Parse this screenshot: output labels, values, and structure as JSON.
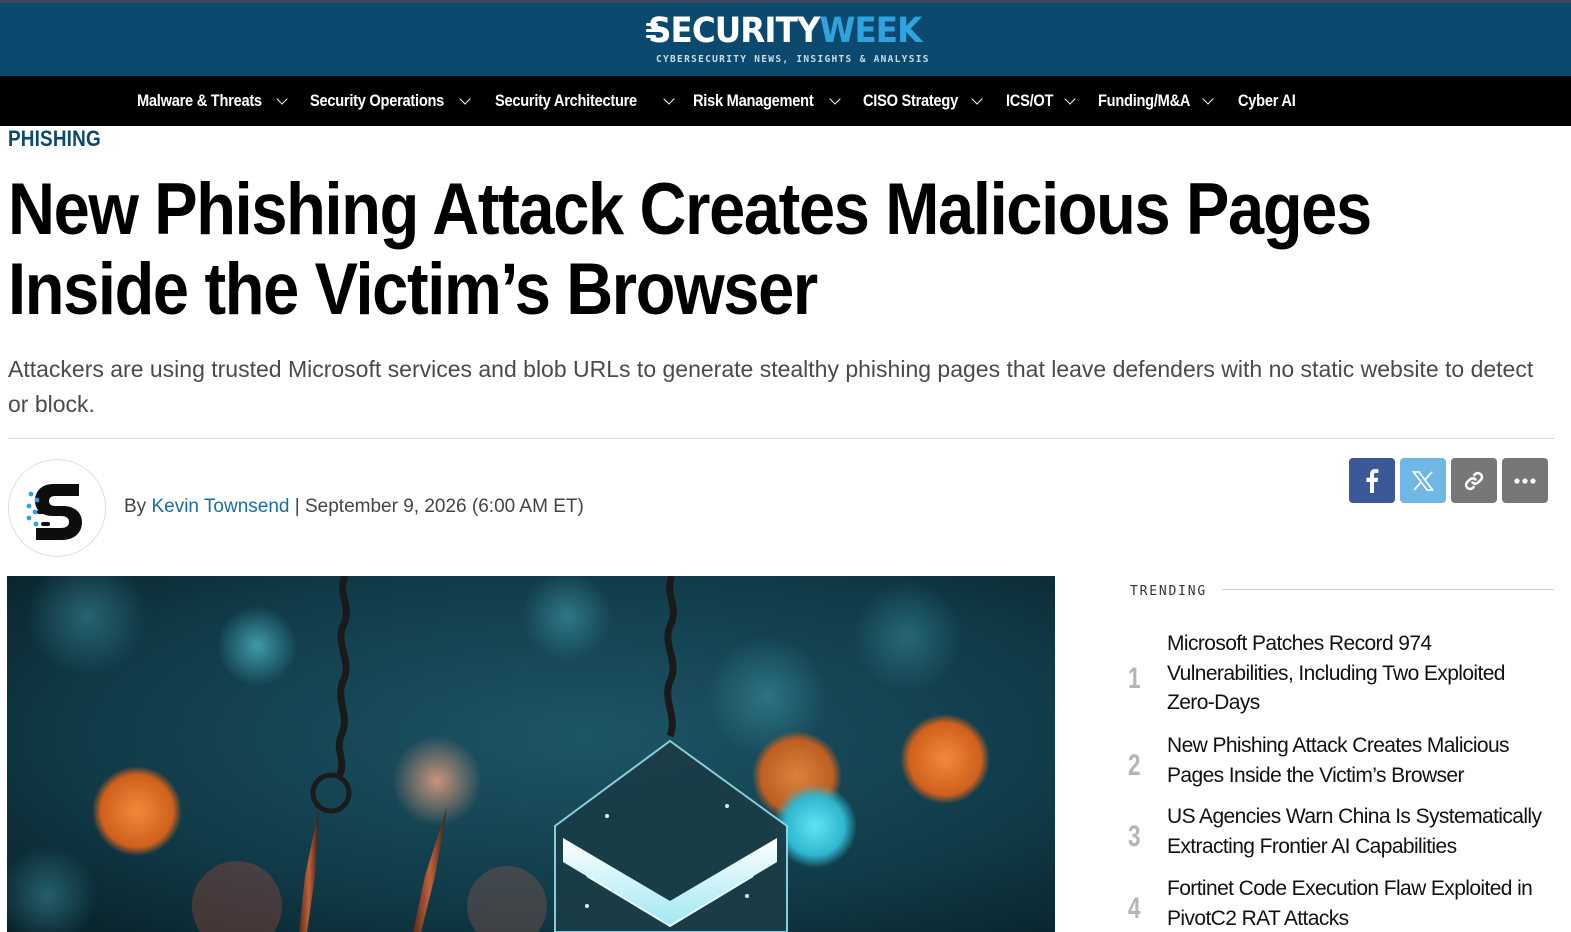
{
  "header": {
    "logo_text_primary": "SECURITY",
    "logo_text_accent": "WEEK",
    "logo_tagline": "CYBERSECURITY NEWS, INSIGHTS & ANALYSIS",
    "colors": {
      "masthead": "#0b4a6e",
      "accent": "#2fa3e0",
      "nav": "#000000"
    }
  },
  "nav": {
    "items": [
      {
        "label": "Malware & Threats",
        "has_dropdown": true
      },
      {
        "label": "Security Operations",
        "has_dropdown": true
      },
      {
        "label": "Security Architecture",
        "has_dropdown": true
      },
      {
        "label": "Risk Management",
        "has_dropdown": true
      },
      {
        "label": "CISO Strategy",
        "has_dropdown": true
      },
      {
        "label": "ICS/OT",
        "has_dropdown": true
      },
      {
        "label": "Funding/M&A",
        "has_dropdown": true
      },
      {
        "label": "Cyber AI",
        "has_dropdown": false
      }
    ]
  },
  "article": {
    "category": "PHISHING",
    "title": "New Phishing Attack Creates Malicious Pages Inside the Victim’s Browser",
    "dek": "Attackers are using trusted Microsoft services and blob URLs to generate stealthy phishing pages that leave defenders with no static website to detect or block.",
    "byline": {
      "prefix": "By",
      "author": "Kevin Townsend",
      "separator": "|",
      "date": "September 9, 2026 (6:00 AM ET)"
    },
    "share": [
      {
        "name": "facebook",
        "icon": "facebook-icon"
      },
      {
        "name": "x",
        "icon": "x-icon"
      },
      {
        "name": "copy-link",
        "icon": "link-icon"
      },
      {
        "name": "more",
        "icon": "more-icon"
      }
    ]
  },
  "trending": {
    "heading": "TRENDING",
    "items": [
      {
        "rank": "1",
        "title": "Microsoft Patches Record 974 Vulnerabilities, Including Two Exploited Zero-Days"
      },
      {
        "rank": "2",
        "title": "New Phishing Attack Creates Malicious Pages Inside the Victim’s Browser"
      },
      {
        "rank": "3",
        "title": "US Agencies Warn China Is Systematically Extracting Frontier AI Capabilities"
      },
      {
        "rank": "4",
        "title": "Fortinet Code Execution Flaw Exploited in PivotC2 RAT Attacks"
      }
    ]
  }
}
